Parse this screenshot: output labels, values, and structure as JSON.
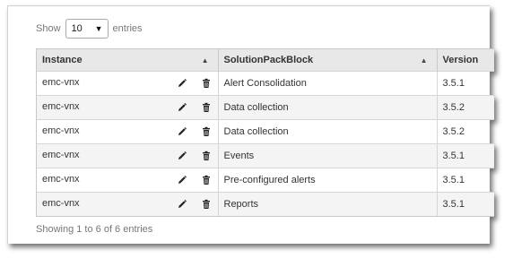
{
  "length_menu": {
    "prefix": "Show",
    "selected": "10",
    "suffix": "entries"
  },
  "columns": [
    {
      "label": "Instance",
      "sort": "▲"
    },
    {
      "label": "SolutionPackBlock",
      "sort": "▲"
    },
    {
      "label": "Version"
    }
  ],
  "rows": [
    {
      "instance": "emc-vnx",
      "block": "Alert Consolidation",
      "version": "3.5.1"
    },
    {
      "instance": "emc-vnx",
      "block": "Data collection",
      "version": "3.5.2"
    },
    {
      "instance": "emc-vnx",
      "block": "Data collection",
      "version": "3.5.2"
    },
    {
      "instance": "emc-vnx",
      "block": "Events",
      "version": "3.5.1"
    },
    {
      "instance": "emc-vnx",
      "block": "Pre-configured alerts",
      "version": "3.5.1"
    },
    {
      "instance": "emc-vnx",
      "block": "Reports",
      "version": "3.5.1"
    }
  ],
  "row_icons": [
    "pencil-icon",
    "trash-icon"
  ],
  "footer_info": "Showing 1 to 6 of 6 entries",
  "colors": {
    "header_bg": "#e8e8e8",
    "stripe_bg": "#f4f4f4",
    "border": "#c8c8c8",
    "muted_text": "#777777"
  }
}
